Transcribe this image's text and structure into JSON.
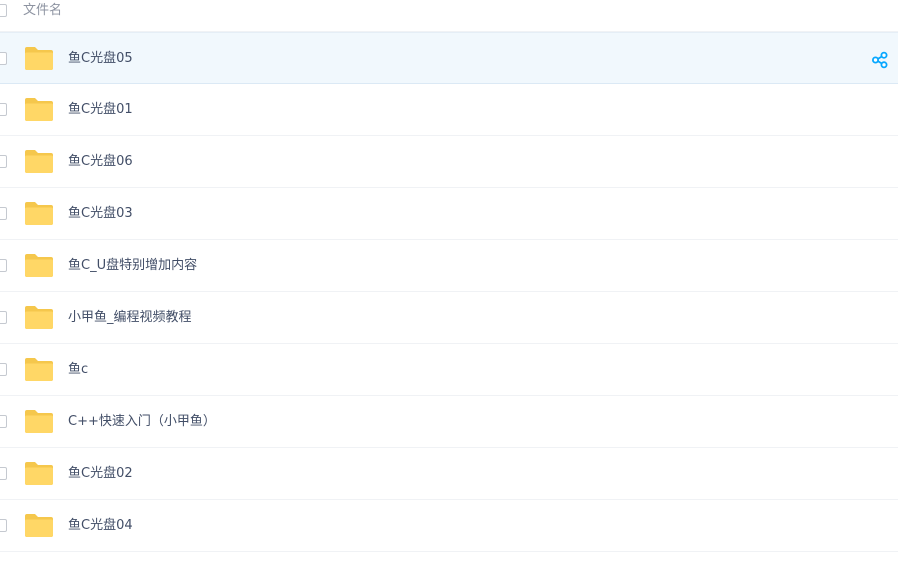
{
  "header": {
    "column_label": "文件名"
  },
  "files": [
    {
      "name": "鱼C光盘05",
      "type": "folder",
      "selected": true
    },
    {
      "name": "鱼C光盘01",
      "type": "folder"
    },
    {
      "name": "鱼C光盘06",
      "type": "folder"
    },
    {
      "name": "鱼C光盘03",
      "type": "folder"
    },
    {
      "name": "鱼C_U盘特别增加内容",
      "type": "folder"
    },
    {
      "name": "小甲鱼_编程视频教程",
      "type": "folder"
    },
    {
      "name": "鱼c",
      "type": "folder"
    },
    {
      "name": "C++快速入门（小甲鱼）",
      "type": "folder"
    },
    {
      "name": "鱼C光盘02",
      "type": "folder"
    },
    {
      "name": "鱼C光盘04",
      "type": "folder"
    }
  ],
  "icons": {
    "folder": "folder-icon",
    "share": "share-icon"
  },
  "colors": {
    "folder_fill": "#ffd766",
    "folder_back": "#f5c74c",
    "share_accent": "#06a7ff",
    "selected_row_bg": "#f1f8fd",
    "text": "#424e67",
    "header_text": "#8d93a1"
  }
}
